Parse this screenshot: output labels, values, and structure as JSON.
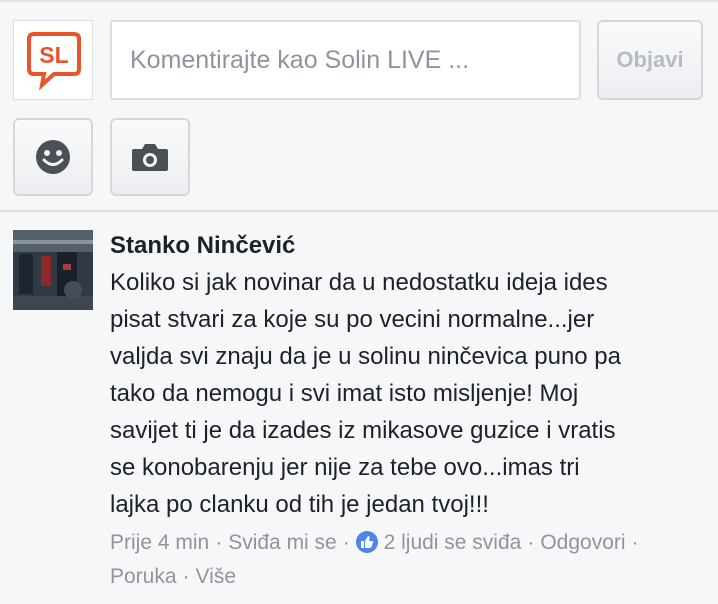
{
  "composer": {
    "brand_logo_text": "SL",
    "input_placeholder": "Komentirajte kao Solin LIVE ...",
    "post_label": "Objavi",
    "emoji_icon": "smiley-icon",
    "camera_icon": "camera-icon"
  },
  "comment": {
    "author": "Stanko Ninčević",
    "lines": [
      "Koliko si jak novinar da u nedostatku ideja ides",
      "pisat stvari za koje su po vecini normalne...jer",
      "valjda svi znaju da je u solinu ninčevica puno pa",
      "tako da nemogu i svi imat isto misljenje! Moj",
      "savijet ti je da izades iz mikasove guzice i vratis",
      "se konobarenju jer nije za tebe ovo...imas tri",
      "lajka po clanku od tih je jedan tvoj!!!"
    ],
    "meta": {
      "time": "Prije 4 min",
      "like_label": "Sviđa mi se",
      "likes_text": "2 ljudi se sviđa",
      "reply_label": "Odgovori",
      "message_label": "Poruka",
      "more_label": "Više",
      "separator": "·"
    }
  },
  "colors": {
    "brand_orange": "#e8552b",
    "icon_gray": "#4b4f56",
    "meta_gray": "#90949c",
    "like_blue": "#4e85e8"
  }
}
